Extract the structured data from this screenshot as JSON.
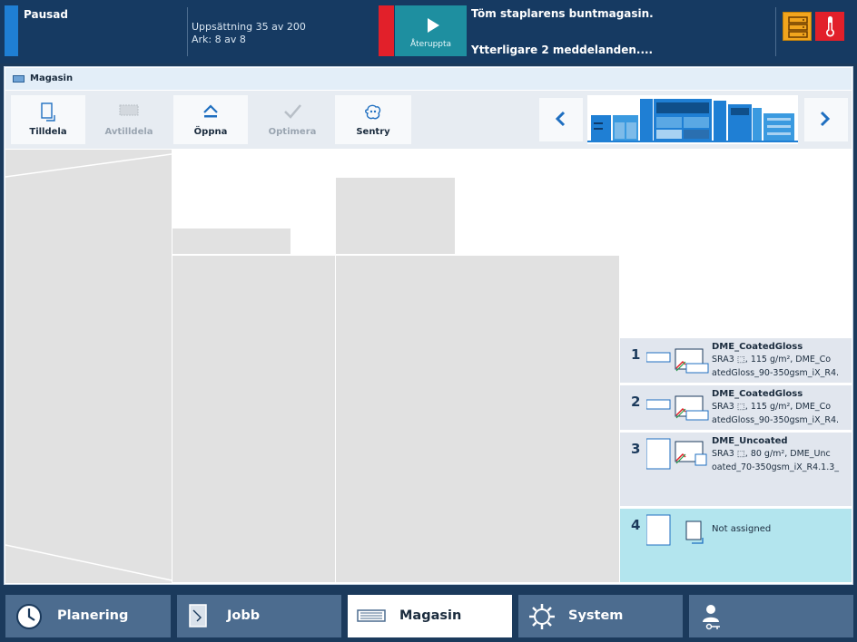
{
  "status": {
    "state": "Pausad",
    "progress_sets": "Uppsättning 35 av 200",
    "progress_sheets": "Ark: 8 av 8",
    "resume_label": "Återuppta",
    "message_primary": "Töm staplarens buntmagasin.",
    "message_more": "Ytterligare 2 meddelanden....",
    "colors": {
      "status": "#1f7fd4",
      "alert": "#e2202a",
      "resume": "#1e8fa0",
      "warning_icon": "#f2a51d",
      "thermo_icon": "#e2202a"
    },
    "icons": [
      "printer-warning-icon",
      "thermometer-icon"
    ]
  },
  "panel": {
    "title": "Magasin",
    "toolbar": [
      {
        "label": "Tilldela",
        "icon": "assign-icon",
        "enabled": true
      },
      {
        "label": "Avtilldela",
        "icon": "unassign-icon",
        "enabled": false
      },
      {
        "label": "Öppna",
        "icon": "eject-icon",
        "enabled": true
      },
      {
        "label": "Optimera",
        "icon": "check-icon",
        "enabled": false
      },
      {
        "label": "Sentry",
        "icon": "sentry-icon",
        "enabled": true
      }
    ],
    "nav": {
      "prev_icon": "chevron-left-icon",
      "next_icon": "chevron-right-icon"
    }
  },
  "trays": [
    {
      "number": "1",
      "name": "DME_CoatedGloss",
      "desc1": "SRA3 ⬚, 115 g/m², DME_Co",
      "desc2": "atedGloss_90-350gsm_iX_R4.",
      "assigned": true
    },
    {
      "number": "2",
      "name": "DME_CoatedGloss",
      "desc1": "SRA3 ⬚, 115 g/m², DME_Co",
      "desc2": "atedGloss_90-350gsm_iX_R4.",
      "assigned": true
    },
    {
      "number": "3",
      "name": "DME_Uncoated",
      "desc1": "SRA3 ⬚, 80 g/m², DME_Unc",
      "desc2": "oated_70-350gsm_iX_R4.1.3_",
      "assigned": true
    },
    {
      "number": "4",
      "name": "Not assigned",
      "assigned": false
    }
  ],
  "bottomnav": [
    {
      "label": "Planering",
      "icon": "clock-icon",
      "active": false
    },
    {
      "label": "Jobb",
      "icon": "document-icon",
      "active": false
    },
    {
      "label": "Magasin",
      "icon": "tray-icon",
      "active": true
    },
    {
      "label": "System",
      "icon": "gear-icon",
      "active": false
    },
    {
      "label": "",
      "icon": "user-key-icon",
      "active": false
    }
  ]
}
